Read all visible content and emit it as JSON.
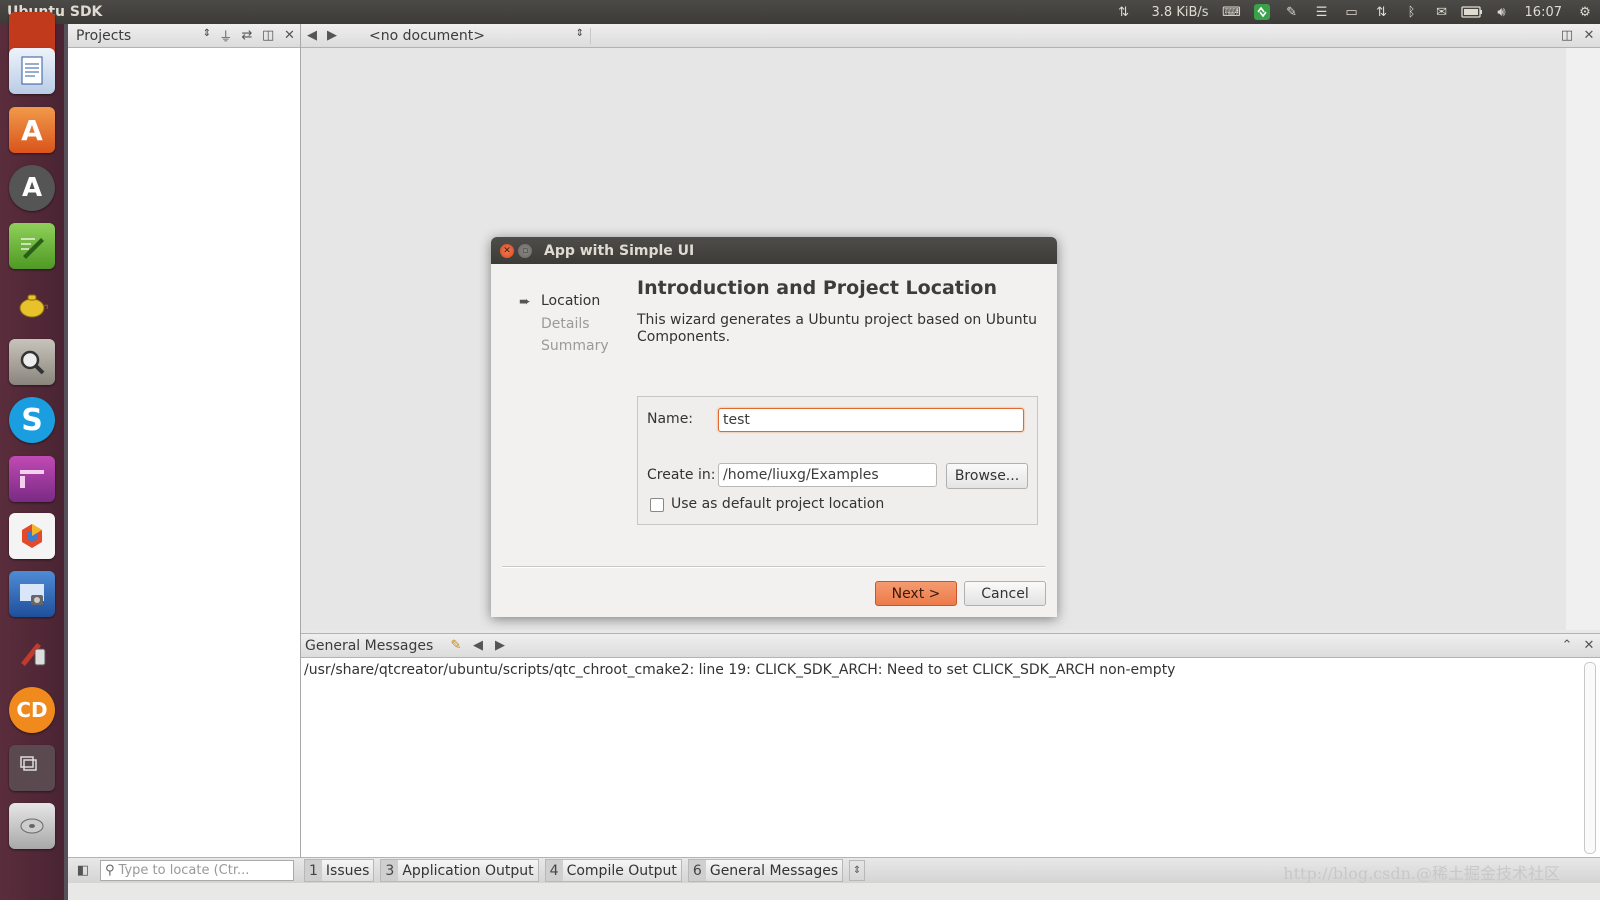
{
  "top_panel": {
    "app_title": "Ubuntu SDK",
    "network_speed": "3.8 KiB/s",
    "clock": "16:07"
  },
  "launcher": {
    "items": [
      "ubuntu-one-icon",
      "libreoffice-writer-icon",
      "software-center-icon",
      "software-updater-icon",
      "text-editor-icon",
      "teapot-app-icon",
      "image-viewer-icon",
      "skype-icon",
      "workspace-switcher-icon",
      "ubuntu-sdk-icon",
      "screenshot-icon",
      "paint-icon",
      "cd-burner-icon",
      "window-manager-icon",
      "disk-icon"
    ]
  },
  "projects_pane": {
    "combo_label": "Projects"
  },
  "editor": {
    "document_combo": "<no document>"
  },
  "output_pane": {
    "title": "General Messages",
    "message": "/usr/share/qtcreator/ubuntu/scripts/qtc_chroot_cmake2: line 19: CLICK_SDK_ARCH: Need to set CLICK_SDK_ARCH non-empty"
  },
  "bottom_bar": {
    "locator_placeholder": "Type to locate (Ctr...",
    "tabs": [
      {
        "num": "1",
        "label": "Issues"
      },
      {
        "num": "3",
        "label": "Application Output"
      },
      {
        "num": "4",
        "label": "Compile Output"
      },
      {
        "num": "6",
        "label": "General Messages"
      }
    ],
    "watermark": "http://blog.csdn.@稀土掘金技术社区"
  },
  "dialog": {
    "title": "App with Simple UI",
    "steps": [
      "Location",
      "Details",
      "Summary"
    ],
    "heading": "Introduction and Project Location",
    "description": "This wizard generates a Ubuntu project based on Ubuntu Components.",
    "name_label": "Name:",
    "name_value": "test",
    "create_in_label": "Create in:",
    "create_in_value": "/home/liuxg/Examples",
    "browse_label": "Browse...",
    "default_location_label": "Use as default project location",
    "default_location_checked": false,
    "next_label": "Next >",
    "cancel_label": "Cancel"
  }
}
